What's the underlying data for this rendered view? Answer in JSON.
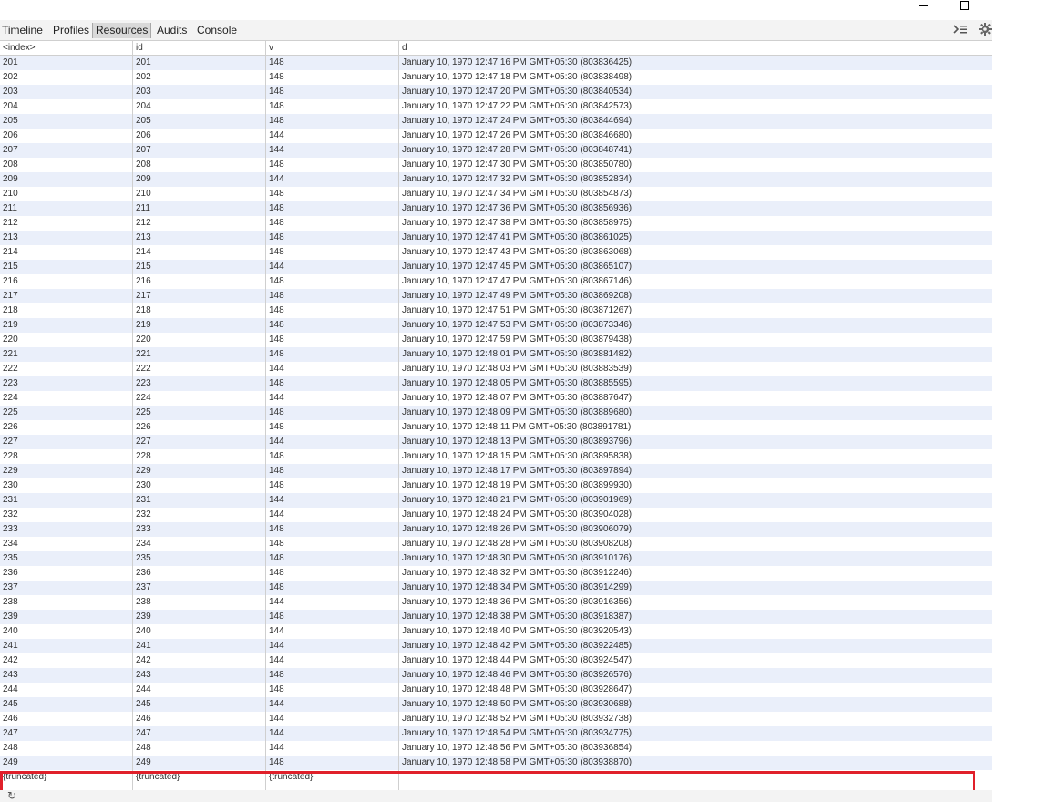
{
  "toolbar": {
    "tabs": [
      {
        "label": "Timeline"
      },
      {
        "label": "Profiles"
      },
      {
        "label": "Resources"
      },
      {
        "label": "Audits"
      },
      {
        "label": "Console"
      }
    ],
    "active_tab": "Resources",
    "icons": [
      "console-drawer-icon",
      "gear-icon"
    ]
  },
  "window": {
    "icons": [
      "minimize-icon",
      "maximize-icon"
    ]
  },
  "grid": {
    "columns": [
      "<index>",
      "id",
      "v",
      "d"
    ],
    "rows": [
      [
        "201",
        "201",
        "148",
        "January 10, 1970 12:47:16 PM GMT+05:30 (803836425)"
      ],
      [
        "202",
        "202",
        "148",
        "January 10, 1970 12:47:18 PM GMT+05:30 (803838498)"
      ],
      [
        "203",
        "203",
        "148",
        "January 10, 1970 12:47:20 PM GMT+05:30 (803840534)"
      ],
      [
        "204",
        "204",
        "148",
        "January 10, 1970 12:47:22 PM GMT+05:30 (803842573)"
      ],
      [
        "205",
        "205",
        "148",
        "January 10, 1970 12:47:24 PM GMT+05:30 (803844694)"
      ],
      [
        "206",
        "206",
        "144",
        "January 10, 1970 12:47:26 PM GMT+05:30 (803846680)"
      ],
      [
        "207",
        "207",
        "144",
        "January 10, 1970 12:47:28 PM GMT+05:30 (803848741)"
      ],
      [
        "208",
        "208",
        "148",
        "January 10, 1970 12:47:30 PM GMT+05:30 (803850780)"
      ],
      [
        "209",
        "209",
        "144",
        "January 10, 1970 12:47:32 PM GMT+05:30 (803852834)"
      ],
      [
        "210",
        "210",
        "148",
        "January 10, 1970 12:47:34 PM GMT+05:30 (803854873)"
      ],
      [
        "211",
        "211",
        "148",
        "January 10, 1970 12:47:36 PM GMT+05:30 (803856936)"
      ],
      [
        "212",
        "212",
        "148",
        "January 10, 1970 12:47:38 PM GMT+05:30 (803858975)"
      ],
      [
        "213",
        "213",
        "148",
        "January 10, 1970 12:47:41 PM GMT+05:30 (803861025)"
      ],
      [
        "214",
        "214",
        "148",
        "January 10, 1970 12:47:43 PM GMT+05:30 (803863068)"
      ],
      [
        "215",
        "215",
        "144",
        "January 10, 1970 12:47:45 PM GMT+05:30 (803865107)"
      ],
      [
        "216",
        "216",
        "148",
        "January 10, 1970 12:47:47 PM GMT+05:30 (803867146)"
      ],
      [
        "217",
        "217",
        "148",
        "January 10, 1970 12:47:49 PM GMT+05:30 (803869208)"
      ],
      [
        "218",
        "218",
        "148",
        "January 10, 1970 12:47:51 PM GMT+05:30 (803871267)"
      ],
      [
        "219",
        "219",
        "148",
        "January 10, 1970 12:47:53 PM GMT+05:30 (803873346)"
      ],
      [
        "220",
        "220",
        "148",
        "January 10, 1970 12:47:59 PM GMT+05:30 (803879438)"
      ],
      [
        "221",
        "221",
        "148",
        "January 10, 1970 12:48:01 PM GMT+05:30 (803881482)"
      ],
      [
        "222",
        "222",
        "144",
        "January 10, 1970 12:48:03 PM GMT+05:30 (803883539)"
      ],
      [
        "223",
        "223",
        "148",
        "January 10, 1970 12:48:05 PM GMT+05:30 (803885595)"
      ],
      [
        "224",
        "224",
        "144",
        "January 10, 1970 12:48:07 PM GMT+05:30 (803887647)"
      ],
      [
        "225",
        "225",
        "148",
        "January 10, 1970 12:48:09 PM GMT+05:30 (803889680)"
      ],
      [
        "226",
        "226",
        "148",
        "January 10, 1970 12:48:11 PM GMT+05:30 (803891781)"
      ],
      [
        "227",
        "227",
        "144",
        "January 10, 1970 12:48:13 PM GMT+05:30 (803893796)"
      ],
      [
        "228",
        "228",
        "148",
        "January 10, 1970 12:48:15 PM GMT+05:30 (803895838)"
      ],
      [
        "229",
        "229",
        "148",
        "January 10, 1970 12:48:17 PM GMT+05:30 (803897894)"
      ],
      [
        "230",
        "230",
        "148",
        "January 10, 1970 12:48:19 PM GMT+05:30 (803899930)"
      ],
      [
        "231",
        "231",
        "144",
        "January 10, 1970 12:48:21 PM GMT+05:30 (803901969)"
      ],
      [
        "232",
        "232",
        "144",
        "January 10, 1970 12:48:24 PM GMT+05:30 (803904028)"
      ],
      [
        "233",
        "233",
        "148",
        "January 10, 1970 12:48:26 PM GMT+05:30 (803906079)"
      ],
      [
        "234",
        "234",
        "148",
        "January 10, 1970 12:48:28 PM GMT+05:30 (803908208)"
      ],
      [
        "235",
        "235",
        "148",
        "January 10, 1970 12:48:30 PM GMT+05:30 (803910176)"
      ],
      [
        "236",
        "236",
        "148",
        "January 10, 1970 12:48:32 PM GMT+05:30 (803912246)"
      ],
      [
        "237",
        "237",
        "148",
        "January 10, 1970 12:48:34 PM GMT+05:30 (803914299)"
      ],
      [
        "238",
        "238",
        "144",
        "January 10, 1970 12:48:36 PM GMT+05:30 (803916356)"
      ],
      [
        "239",
        "239",
        "148",
        "January 10, 1970 12:48:38 PM GMT+05:30 (803918387)"
      ],
      [
        "240",
        "240",
        "144",
        "January 10, 1970 12:48:40 PM GMT+05:30 (803920543)"
      ],
      [
        "241",
        "241",
        "144",
        "January 10, 1970 12:48:42 PM GMT+05:30 (803922485)"
      ],
      [
        "242",
        "242",
        "144",
        "January 10, 1970 12:48:44 PM GMT+05:30 (803924547)"
      ],
      [
        "243",
        "243",
        "148",
        "January 10, 1970 12:48:46 PM GMT+05:30 (803926576)"
      ],
      [
        "244",
        "244",
        "148",
        "January 10, 1970 12:48:48 PM GMT+05:30 (803928647)"
      ],
      [
        "245",
        "245",
        "144",
        "January 10, 1970 12:48:50 PM GMT+05:30 (803930688)"
      ],
      [
        "246",
        "246",
        "144",
        "January 10, 1970 12:48:52 PM GMT+05:30 (803932738)"
      ],
      [
        "247",
        "247",
        "144",
        "January 10, 1970 12:48:54 PM GMT+05:30 (803934775)"
      ],
      [
        "248",
        "248",
        "144",
        "January 10, 1970 12:48:56 PM GMT+05:30 (803936854)"
      ],
      [
        "249",
        "249",
        "148",
        "January 10, 1970 12:48:58 PM GMT+05:30 (803938870)"
      ],
      [
        "{truncated}",
        "{truncated}",
        "{truncated}",
        ""
      ]
    ]
  },
  "status_bar": {
    "icons": [
      "refresh-icon"
    ]
  },
  "colors": {
    "row_stripe": "#eaeffa",
    "highlight": "#e0202a",
    "grid_line": "#cfcfcf"
  }
}
